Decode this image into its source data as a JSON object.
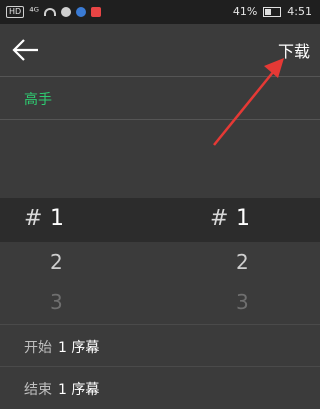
{
  "status_bar": {
    "carrier_1": "HD",
    "carrier_2": "⁴ᴳ",
    "battery": "41%",
    "time": "4:51"
  },
  "toolbar": {
    "back_icon": "arrow-left-icon",
    "download_label": "下载"
  },
  "difficulty": {
    "label": "高手",
    "color": "#2ecc71"
  },
  "picker": {
    "left": {
      "hash": "#",
      "items": [
        "1",
        "2",
        "3"
      ]
    },
    "right": {
      "hash": "#",
      "items": [
        "1",
        "2",
        "3"
      ]
    }
  },
  "range": {
    "start_label": "开始",
    "start_value": "1 序幕",
    "end_label": "结束",
    "end_value": "1 序幕"
  },
  "annotation_color": "#e53935"
}
